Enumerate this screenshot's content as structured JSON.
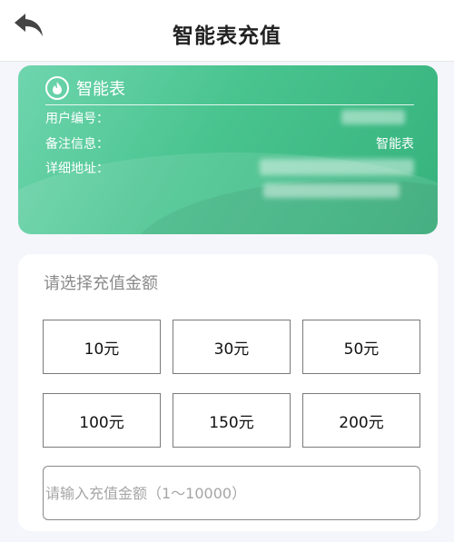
{
  "header": {
    "title": "智能表充值",
    "back_icon": "back-arrow-icon"
  },
  "meter_card": {
    "icon": "flame-icon",
    "name": "智能表",
    "rows": [
      {
        "label": "用户编号：",
        "value": ""
      },
      {
        "label": "备注信息：",
        "value": "智能表"
      },
      {
        "label": "详细地址：",
        "value": ""
      }
    ],
    "colors": {
      "start": "#6fd5ae",
      "end": "#36b27d"
    }
  },
  "recharge": {
    "prompt": "请选择充值金额",
    "amounts": [
      "10元",
      "30元",
      "50元",
      "100元",
      "150元",
      "200元"
    ],
    "custom_placeholder": "请输入充值金额（1～10000）"
  }
}
